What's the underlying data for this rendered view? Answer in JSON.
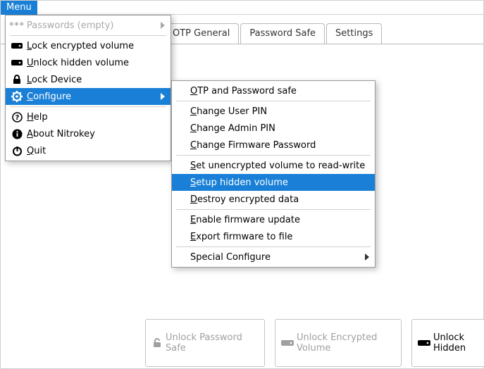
{
  "menubar": {
    "menu_label": "Menu"
  },
  "tabs": {
    "otp_general": "OTP General",
    "password_safe": "Password Safe",
    "settings": "Settings"
  },
  "mainmenu": {
    "passwords": "Passwords (empty)",
    "lock_encrypted": "ock encrypted volume",
    "unlock_hidden": "nlock hidden volume",
    "lock_device": "ock Device",
    "configure": "onfigure",
    "help": "elp",
    "about": "bout Nitrokey",
    "quit": "uit",
    "u_lock_enc": "L",
    "u_unlock_hidden": "U",
    "u_lock_device": "L",
    "u_configure": "C",
    "u_help": "H",
    "u_about": "A",
    "u_quit": "Q",
    "stars": "***"
  },
  "submenu": {
    "otp_pw": "TP and Password safe",
    "change_user_pin": "hange User PIN",
    "change_admin_pin": "hange Admin PIN",
    "change_fw_pw": "hange Firmware Password",
    "set_unenc": "et unencrypted volume to read-write",
    "setup_hidden": "etup hidden volume",
    "destroy_enc": "estroy encrypted data",
    "enable_fw": "nable firmware update",
    "export_fw": "xport firmware to file",
    "special": "Special Configure",
    "u_otp": "O",
    "u_cup": "C",
    "u_cap": "C",
    "u_cfw": "C",
    "u_set": "S",
    "u_setup": "S",
    "u_destroy": "D",
    "u_enable": "E",
    "u_export": "E"
  },
  "buttons": {
    "unlock_pwsafe": "Unlock Password Safe",
    "unlock_encvol": "Unlock Encrypted Volume",
    "unlock_hidden": "Unlock Hidden "
  }
}
